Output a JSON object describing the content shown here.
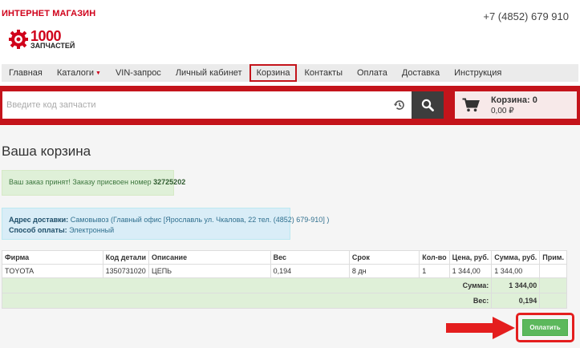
{
  "header": {
    "shop_label": "ИНТЕРНЕТ МАГАЗИН",
    "logo_number": "1000",
    "logo_sub": "ЗАПЧАСТЕЙ",
    "phone": "+7 (4852) 679 910"
  },
  "nav": {
    "items": [
      {
        "label": "Главная"
      },
      {
        "label": "Каталоги"
      },
      {
        "label": "VIN-запрос"
      },
      {
        "label": "Личный кабинет"
      },
      {
        "label": "Корзина"
      },
      {
        "label": "Контакты"
      },
      {
        "label": "Оплата"
      },
      {
        "label": "Доставка"
      },
      {
        "label": "Инструкция"
      }
    ],
    "active_index": 4
  },
  "search": {
    "placeholder": "Введите код запчасти"
  },
  "cart": {
    "title": "Корзина: 0",
    "sum": "0,00 ₽"
  },
  "page": {
    "title": "Ваша корзина"
  },
  "order_alert": {
    "text": "Ваш заказ принят! Заказу присвоен номер ",
    "number": "32725202"
  },
  "delivery": {
    "address_label": "Адрес доставки:",
    "address_value": " Самовывоз (Главный офис [Ярославль ул. Чкалова, 22 тел. (4852) 679-910] )",
    "payment_label": "Способ оплаты:",
    "payment_value": " Электронный"
  },
  "table": {
    "headers": [
      "Фирма",
      "Код детали",
      "Описание",
      "Вес",
      "Срок",
      "Кол-во",
      "Цена, руб.",
      "Сумма, руб.",
      "Прим."
    ],
    "rows": [
      [
        "TOYOTA",
        "1350731020",
        "ЦЕПЬ",
        "0,194",
        "8 дн",
        "1",
        "1 344,00",
        "1 344,00",
        ""
      ]
    ],
    "sum_label": "Сумма:",
    "sum_value": "1 344,00",
    "weight_label": "Вес:",
    "weight_value": "0,194"
  },
  "actions": {
    "pay_label": "Оплатить"
  },
  "colors": {
    "brand_red": "#c4141b",
    "success_green": "#5cb85c",
    "annotation_red": "#e41e1e"
  }
}
